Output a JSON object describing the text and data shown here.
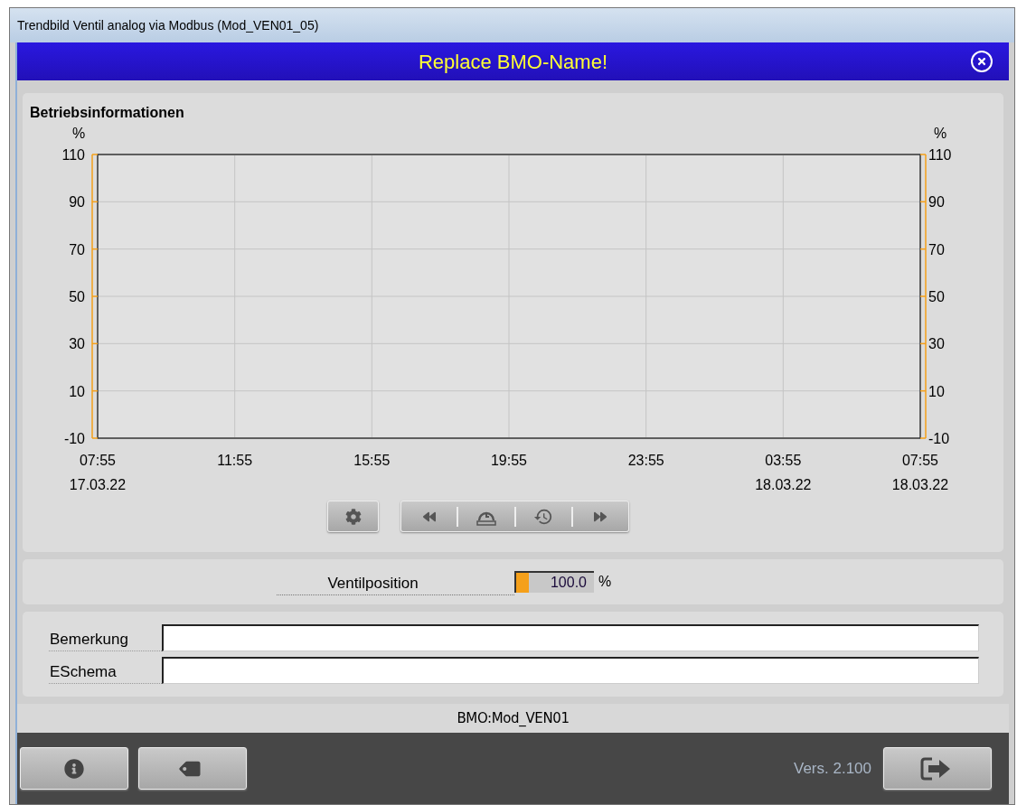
{
  "window": {
    "title": "Trendbild Ventil analog via Modbus (Mod_VEN01_05)"
  },
  "header": {
    "title": "Replace BMO-Name!"
  },
  "chart_panel": {
    "title": "Betriebsinformationen",
    "left_unit": "%",
    "right_unit": "%",
    "right_ticks": [
      "110",
      "90",
      "70",
      "50",
      "30",
      "10",
      "-10"
    ],
    "chart_data": {
      "type": "line",
      "grid": true,
      "ylim": [
        -10,
        110
      ],
      "yticks": [
        {
          "value": -10,
          "label": "-10"
        },
        {
          "value": 10,
          "label": "10"
        },
        {
          "value": 30,
          "label": "30"
        },
        {
          "value": 50,
          "label": "50"
        },
        {
          "value": 70,
          "label": "70"
        },
        {
          "value": 90,
          "label": "90"
        },
        {
          "value": 110,
          "label": "110"
        }
      ],
      "categories": [
        "07:55\n17.03.22",
        "11:55",
        "15:55",
        "19:55",
        "23:55",
        "03:55\n18.03.22",
        "07:55\n18.03.22"
      ]
    },
    "toolbar": [
      {
        "kind": "settings"
      },
      {
        "kind": "back"
      },
      {
        "kind": "time-range"
      },
      {
        "kind": "history"
      },
      {
        "kind": "forward"
      }
    ]
  },
  "values": [
    {
      "label": "Ventilposition",
      "value": "100.0",
      "unit": "%"
    }
  ],
  "fields": [
    {
      "label": "Bemerkung"
    },
    {
      "label": "ESchema"
    }
  ],
  "status_bar": {
    "text": "BMO:Mod_VEN01"
  },
  "footer": {
    "version": "Vers. 2.100",
    "buttons": [
      {
        "kind": "info"
      },
      {
        "kind": "tag"
      }
    ],
    "exit": {
      "kind": "exit"
    }
  }
}
